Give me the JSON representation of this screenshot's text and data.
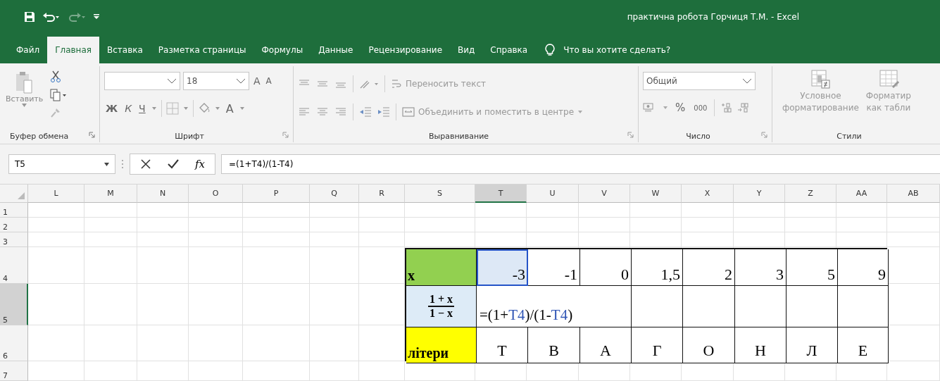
{
  "window": {
    "title": "практична робота Горчиця Т.М.  -  Excel"
  },
  "quick_access": [
    {
      "kind": "save",
      "disabled": false
    },
    {
      "kind": "undo",
      "disabled": false
    },
    {
      "kind": "redo",
      "disabled": true
    },
    {
      "kind": "customize",
      "disabled": false
    }
  ],
  "tabs": [
    {
      "label": "Файл",
      "selected": false
    },
    {
      "label": "Главная",
      "selected": true
    },
    {
      "label": "Вставка",
      "selected": false
    },
    {
      "label": "Разметка страницы",
      "selected": false
    },
    {
      "label": "Формулы",
      "selected": false
    },
    {
      "label": "Данные",
      "selected": false
    },
    {
      "label": "Рецензирование",
      "selected": false
    },
    {
      "label": "Вид",
      "selected": false
    },
    {
      "label": "Справка",
      "selected": false
    }
  ],
  "tell_me": {
    "placeholder": "Что вы хотите сделать?"
  },
  "ribbon": {
    "clipboard": {
      "label": "Буфер обмена",
      "paste": "Вставить"
    },
    "font": {
      "label": "Шрифт",
      "size": "18",
      "grow": "A",
      "shrink": "A",
      "bold": "Ж",
      "italic": "К",
      "underline": "Ч",
      "font_color": "A"
    },
    "alignment": {
      "label": "Выравнивание",
      "wrap": "Переносить текст",
      "merge": "Объединить и поместить в центре"
    },
    "number": {
      "label": "Число",
      "format": "Общий",
      "percent": "%",
      "thousands": "000"
    },
    "styles": {
      "label": "Стили",
      "conditional": [
        "Условное",
        "форматирование"
      ],
      "table": [
        "Форматир",
        "как табли"
      ]
    }
  },
  "formula_bar": {
    "name_box": "T5",
    "fx": "fx",
    "formula": "=(1+T4)/(1-T4)"
  },
  "sheet": {
    "columns": [
      {
        "label": "L",
        "selected": false
      },
      {
        "label": "M",
        "selected": false
      },
      {
        "label": "N",
        "selected": false
      },
      {
        "label": "O",
        "selected": false
      },
      {
        "label": "P",
        "selected": false
      },
      {
        "label": "Q",
        "selected": false
      },
      {
        "label": "R",
        "selected": false
      },
      {
        "label": "S",
        "selected": false
      },
      {
        "label": "T",
        "selected": true
      },
      {
        "label": "U",
        "selected": false
      },
      {
        "label": "V",
        "selected": false
      },
      {
        "label": "W",
        "selected": false
      },
      {
        "label": "X",
        "selected": false
      },
      {
        "label": "Y",
        "selected": false
      },
      {
        "label": "Z",
        "selected": false
      },
      {
        "label": "AA",
        "selected": false
      },
      {
        "label": "AB",
        "selected": false
      }
    ],
    "rows": [
      {
        "label": "1",
        "selected": false
      },
      {
        "label": "2",
        "selected": false
      },
      {
        "label": "3",
        "selected": false
      },
      {
        "label": "4",
        "selected": false
      },
      {
        "label": "5",
        "selected": true
      },
      {
        "label": "6",
        "selected": false
      },
      {
        "label": "7",
        "selected": false
      }
    ],
    "data_table": [
      {
        "cells": [
          {
            "kind": "label",
            "text": "x",
            "color": "#92d050"
          },
          {
            "kind": "number",
            "text": "-3",
            "selected": true
          },
          {
            "kind": "number",
            "text": "-1",
            "selected": false
          },
          {
            "kind": "number",
            "text": "0",
            "selected": false
          },
          {
            "kind": "number",
            "text": "1,5",
            "selected": false
          },
          {
            "kind": "number",
            "text": "2",
            "selected": false
          },
          {
            "kind": "number",
            "text": "3",
            "selected": false
          },
          {
            "kind": "number",
            "text": "5",
            "selected": false
          },
          {
            "kind": "number",
            "text": "9",
            "selected": false
          }
        ]
      },
      {
        "cells": [
          {
            "kind": "fraction",
            "numerator": "1 + x",
            "denominator": "1 − x",
            "color": "#ddebf7"
          },
          {
            "kind": "formula",
            "segments": [
              {
                "text": "=(1+",
                "kind": "text"
              },
              {
                "text": "T4",
                "kind": "reference"
              },
              {
                "text": ")/(1-",
                "kind": "text"
              },
              {
                "text": "T4",
                "kind": "reference"
              },
              {
                "text": ")",
                "kind": "text"
              }
            ]
          }
        ]
      },
      {
        "cells": [
          {
            "kind": "label",
            "text": "літери",
            "color": "#ffff00"
          },
          {
            "kind": "letter",
            "text": "Т"
          },
          {
            "kind": "letter",
            "text": "В"
          },
          {
            "kind": "letter",
            "text": "А"
          },
          {
            "kind": "letter",
            "text": "Г"
          },
          {
            "kind": "letter",
            "text": "О"
          },
          {
            "kind": "letter",
            "text": "Н"
          },
          {
            "kind": "letter",
            "text": "Л"
          },
          {
            "kind": "letter",
            "text": "Е"
          }
        ]
      }
    ]
  }
}
